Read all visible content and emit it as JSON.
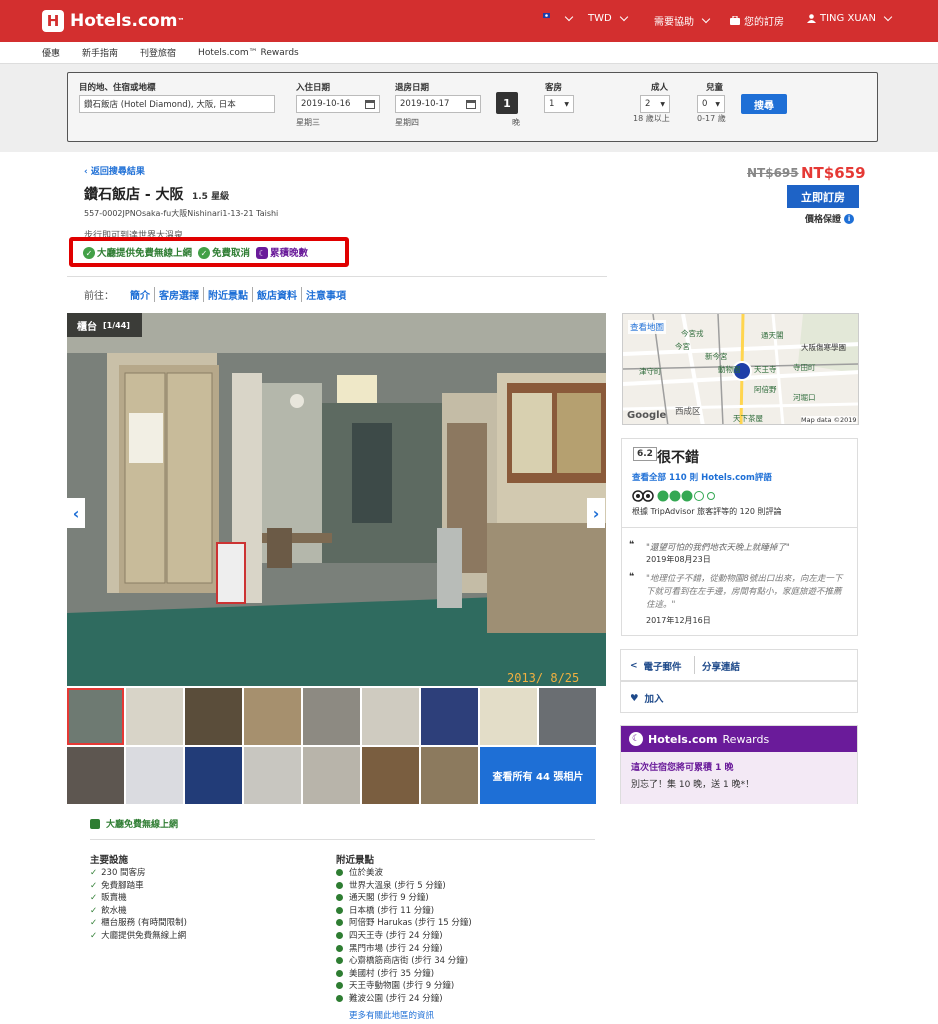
{
  "header": {
    "brand": "Hotels.com",
    "brand_tm": "™",
    "currency": "TWD",
    "help": "需要協助",
    "bookings": "您的訂房",
    "user": "TING XUAN"
  },
  "subnav": [
    "優惠",
    "新手指南",
    "刊登旅宿",
    "Hotels.com™ Rewards"
  ],
  "search": {
    "destination_label": "目的地、住宿或地標",
    "destination_value": "鑽石飯店 (Hotel Diamond), 大阪, 日本",
    "checkin_label": "入住日期",
    "checkin_value": "2019-10-16",
    "checkin_day": "星期三",
    "checkout_label": "退房日期",
    "checkout_value": "2019-10-17",
    "checkout_day": "星期四",
    "nights": "1",
    "nights_unit": "晚",
    "rooms_label": "客房",
    "rooms_value": "1",
    "adults_label": "成人",
    "adults_value": "2",
    "adults_note": "18 歲以上",
    "children_label": "兒童",
    "children_value": "0",
    "children_note": "0-17 歲",
    "search_button": "搜尋"
  },
  "hotel": {
    "back_link": "返回搜尋結果",
    "name": "鑽石飯店 - 大阪",
    "stars": "1.5 星級",
    "address": "557-0002JPNOsaka-fu大阪Nishinari1-13-21 Taishi",
    "partial_text": "步行即可到達世界大溫泉",
    "features": [
      "大廳提供免費無線上網",
      "免費取消",
      "累積晚數"
    ]
  },
  "price": {
    "old": "NT$695",
    "new": "NT$659",
    "book_button": "立即訂房",
    "guarantee": "價格保證"
  },
  "tabs": {
    "prefix": "前往：",
    "items": [
      "簡介",
      "客房選擇",
      "附近景點",
      "飯店資料",
      "注意事項"
    ]
  },
  "photo": {
    "label": "櫃台",
    "counter": "[1/44]",
    "watermark": "2013/ 8/25",
    "view_all": "查看所有 44 張相片"
  },
  "map": {
    "view_map": "查看地圖",
    "attribution": "Map data ©2019",
    "google": "Google",
    "places": [
      "今宮戎",
      "今宮",
      "通天閣",
      "大阪傷寒學園",
      "新今宮",
      "津守町",
      "動物園",
      "天王寺",
      "寺田町",
      "西成区",
      "阿倍野",
      "河堀口",
      "天下茶屋"
    ]
  },
  "reviews": {
    "score": "6.2",
    "score_text": "很不錯",
    "see_all": "查看全部 110 則 Hotels.com評語",
    "tripadvisor": "根據 TripAdvisor 旅客評等的 120 則評論",
    "quote1": "\"還望可怕的我們地衣天晚上就睡掉了\"",
    "date1": "2019年08月23日",
    "quote2": "\"地理位子不錯，從動物園8號出口出來，向左走一下下就可看到在左手邊，房間有點小，家庭旅遊不推薦住這。\"",
    "date2": "2017年12月16日"
  },
  "share": {
    "email": "電子郵件",
    "link": "分享連結",
    "add": "加入"
  },
  "rewards": {
    "brand": "Hotels.com",
    "brand2": "Rewards",
    "line1": "這次住宿您將可累積 1 晚",
    "line2": "別忘了！集 10 晚，送 1 晚*！"
  },
  "wifi_note": "大廳免費無線上網",
  "facilities": {
    "title": "主要設施",
    "items": [
      "230 間客房",
      "免費腳踏車",
      "販賣機",
      "飲水機",
      "櫃台服務 (有時間限制)",
      "大廳提供免費無線上網"
    ]
  },
  "nearby": {
    "title": "附近景點",
    "items": [
      "位於美波",
      "世界大溫泉 (步行 5 分鐘)",
      "通天閣 (步行 9 分鐘)",
      "日本橋 (步行 11 分鐘)",
      "阿倍野 Harukas (步行 15 分鐘)",
      "四天王寺 (步行 24 分鐘)",
      "黑門市場 (步行 24 分鐘)",
      "心齋橋筋商店街 (步行 34 分鐘)",
      "美國村 (步行 35 分鐘)",
      "天王寺動物園 (步行 9 分鐘)",
      "難波公園 (步行 24 分鐘)"
    ],
    "more": "更多有關此地區的資訊"
  },
  "colors": {
    "brand_red": "#d32f2f",
    "link_blue": "#1e6fd6",
    "price_red": "#e53935",
    "feature_green": "#2e7d32",
    "rewards_purple": "#6a1b9a"
  }
}
